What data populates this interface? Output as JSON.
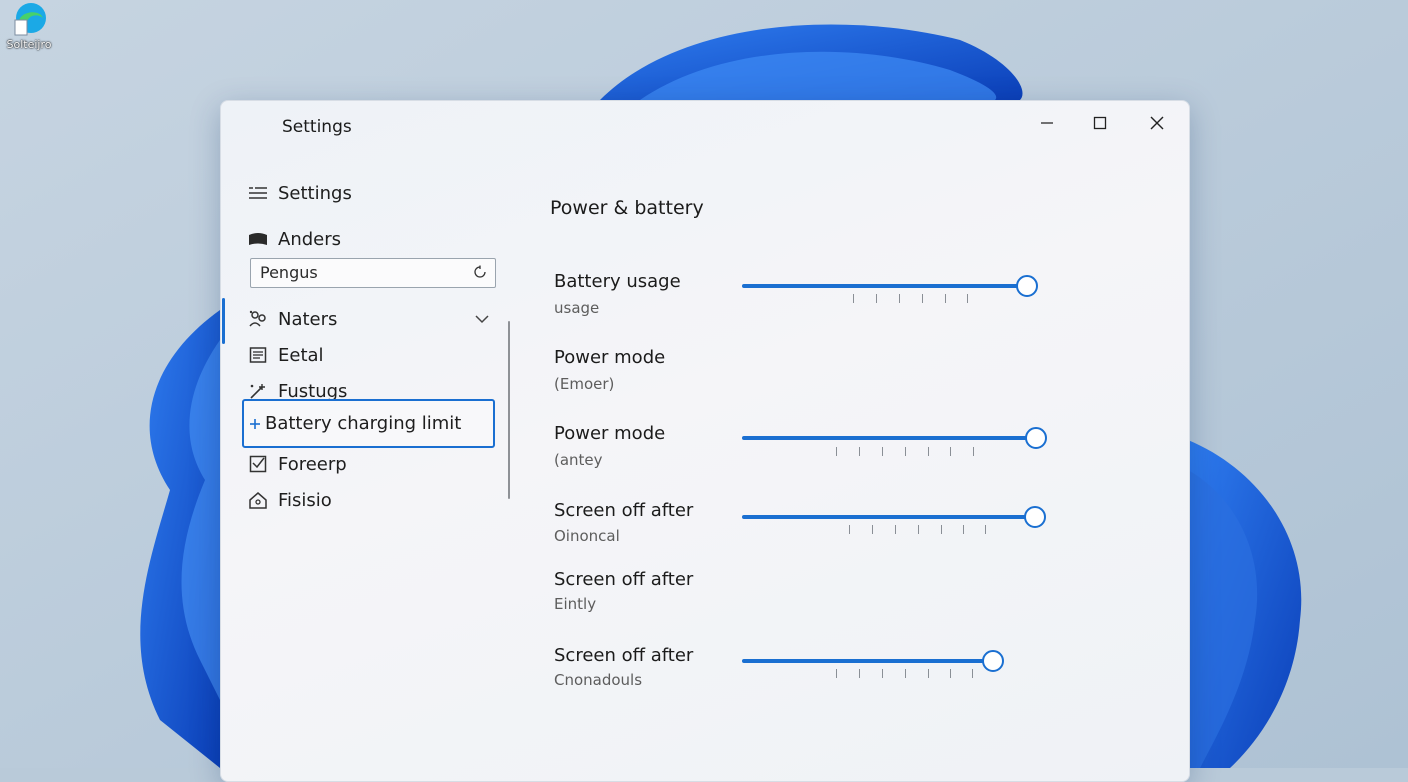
{
  "desktop": {
    "icon_label": "Solteijro",
    "icon": "edge-browser-icon"
  },
  "window": {
    "title": "Settings",
    "controls": {
      "minimize": "minimize-icon",
      "maximize": "maximize-icon",
      "close": "close-icon"
    }
  },
  "sidebar": {
    "header": "Settings",
    "user": "Anders",
    "search": {
      "value": "Pengus",
      "placeholder": ""
    },
    "items": [
      {
        "label": "Naters",
        "icon": "people-icon",
        "expandable": true
      },
      {
        "label": "Eetal",
        "icon": "document-icon"
      },
      {
        "label": "Fustugs",
        "icon": "sparkle-icon"
      },
      {
        "label": "Battery charging limit",
        "icon": "battery-plus-icon",
        "selected": true
      },
      {
        "label": "Foreerp",
        "icon": "checkbox-icon"
      },
      {
        "label": "Fisisio",
        "icon": "home-icon"
      }
    ]
  },
  "content": {
    "title": "Power & battery",
    "rows": [
      {
        "label": "Battery usage",
        "sub": "usage",
        "control": "slider+toggle-off",
        "slider_value": 1.0,
        "toggle": "off"
      },
      {
        "label": "Power mode",
        "sub": "(Emoer)",
        "control": "toggle-on",
        "toggle": "on"
      },
      {
        "label": "Power mode",
        "sub": "(antey",
        "control": "slider+toggle-on",
        "slider_value": 1.0,
        "toggle": "on"
      },
      {
        "label": "Screen off after",
        "sub": "Oinoncal",
        "control": "slider+toggle-off",
        "slider_value": 1.0,
        "toggle": "off"
      },
      {
        "label": "Screen off after",
        "sub": "Eintly",
        "control": "toggle-outline-on",
        "toggle": "on"
      },
      {
        "label": "Screen off after",
        "sub": "Cnonadouls",
        "control": "slider+xx",
        "slider_value": 1.0
      }
    ]
  },
  "colors": {
    "accent": "#1a6fd1",
    "window_bg": "#f1f3f7",
    "wallpaper": "#b9cad9"
  }
}
